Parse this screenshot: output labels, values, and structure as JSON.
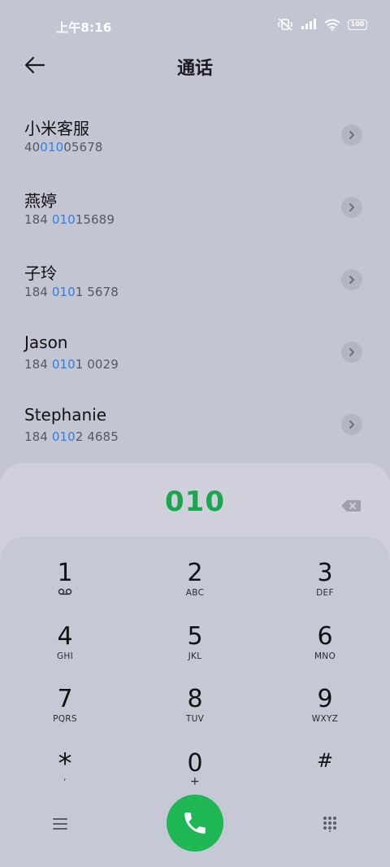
{
  "status_bar": {
    "time": "上午8:16",
    "battery": "100"
  },
  "header": {
    "title": "通话"
  },
  "contacts": [
    {
      "name": "小米客服",
      "number_parts": [
        "40",
        "010",
        "05678"
      ]
    },
    {
      "name": "燕婷",
      "number_parts": [
        "184 ",
        "010",
        "15689"
      ]
    },
    {
      "name": "子玲",
      "number_parts": [
        "184 ",
        "010",
        "1 5678"
      ]
    },
    {
      "name": "Jason",
      "number_parts": [
        "184 ",
        "010",
        "1 0029"
      ]
    },
    {
      "name": "Stephanie",
      "number_parts": [
        "184 ",
        "010",
        "2 4685"
      ]
    }
  ],
  "dialer": {
    "input": "010"
  },
  "keypad": {
    "k1": {
      "digit": "1",
      "letters": ""
    },
    "k2": {
      "digit": "2",
      "letters": "ABC"
    },
    "k3": {
      "digit": "3",
      "letters": "DEF"
    },
    "k4": {
      "digit": "4",
      "letters": "GHI"
    },
    "k5": {
      "digit": "5",
      "letters": "JKL"
    },
    "k6": {
      "digit": "6",
      "letters": "MNO"
    },
    "k7": {
      "digit": "7",
      "letters": "PQRS"
    },
    "k8": {
      "digit": "8",
      "letters": "TUV"
    },
    "k9": {
      "digit": "9",
      "letters": "WXYZ"
    },
    "kstar": {
      "digit": "*",
      "letters": ","
    },
    "k0": {
      "digit": "0",
      "letters": "+"
    },
    "khash": {
      "digit": "#",
      "letters": ""
    }
  },
  "colors": {
    "background": "#c4c5d3",
    "highlight": "#2f7fe0",
    "call_green": "#1fb655",
    "dial_text": "#1aa64c"
  },
  "icons": {
    "back": "back-arrow-icon",
    "voicemail": "voicemail-icon",
    "menu": "menu-icon",
    "call": "phone-icon",
    "dialpad": "dialpad-icon",
    "backspace": "backspace-icon"
  }
}
